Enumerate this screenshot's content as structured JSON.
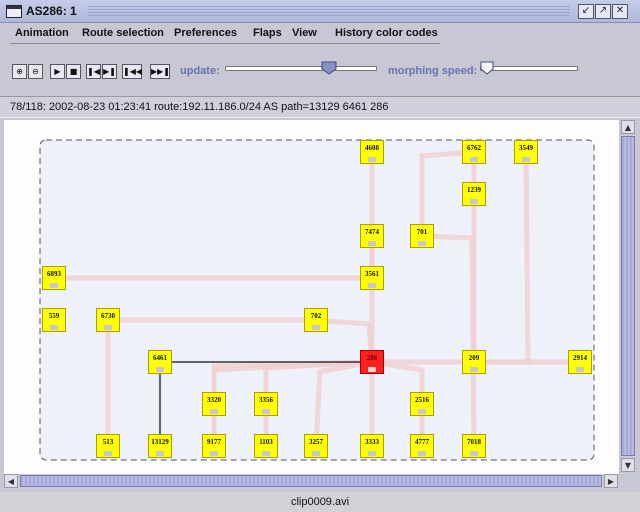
{
  "window": {
    "title": "AS286: 1",
    "buttons": [
      "iconify",
      "maximize",
      "close"
    ]
  },
  "menu": {
    "items": [
      "Animation",
      "Route selection",
      "Preferences",
      "Flaps",
      "View",
      "History color codes"
    ]
  },
  "toolbar": {
    "buttons": [
      "zoom-in",
      "zoom-out",
      "play",
      "stop",
      "step-back",
      "step-forward",
      "rewind",
      "fast-forward"
    ],
    "update_label": "update:",
    "update_value": 0.68,
    "morphing_label": "morphing speed:",
    "morphing_value": 0.06
  },
  "status": {
    "text": "78/118: 2002-08-23 01:23:41 route:192.11.186.0/24 AS path=13129 6461 286"
  },
  "graph": {
    "colors": {
      "node": "#ffff00",
      "selected_node": "#ff2020",
      "edge": "#f0d0d0",
      "path_edge": "#333333"
    },
    "nodes": [
      {
        "id": "4608"
      },
      {
        "id": "6762"
      },
      {
        "id": "3549"
      },
      {
        "id": "1239"
      },
      {
        "id": "7474"
      },
      {
        "id": "701"
      },
      {
        "id": "6893"
      },
      {
        "id": "3561"
      },
      {
        "id": "559"
      },
      {
        "id": "6730"
      },
      {
        "id": "702"
      },
      {
        "id": "6461"
      },
      {
        "id": "286",
        "selected": true
      },
      {
        "id": "209"
      },
      {
        "id": "2914"
      },
      {
        "id": "3320"
      },
      {
        "id": "3356"
      },
      {
        "id": "2516"
      },
      {
        "id": "513"
      },
      {
        "id": "13129"
      },
      {
        "id": "9177"
      },
      {
        "id": "1103"
      },
      {
        "id": "3257"
      },
      {
        "id": "3333"
      },
      {
        "id": "4777"
      },
      {
        "id": "7018"
      }
    ]
  },
  "footer": {
    "filename": "clip0009.avi"
  }
}
